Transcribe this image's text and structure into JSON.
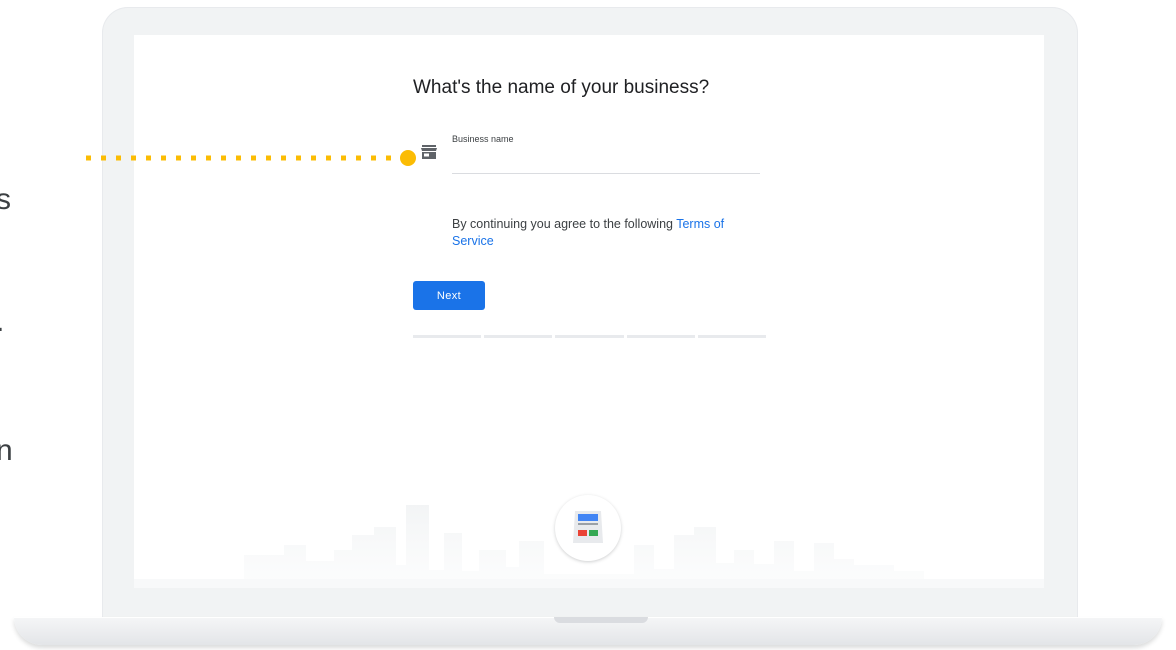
{
  "edge_fragments": [
    "s",
    ".",
    "n"
  ],
  "form": {
    "title": "What's the name of your business?",
    "field_label": "Business name",
    "field_value": "",
    "terms_prefix": "By continuing you agree to the following ",
    "terms_link": "Terms of Service",
    "next_label": "Next"
  },
  "progress": {
    "steps": 5,
    "current": 0
  },
  "colors": {
    "accent": "#1a73e8",
    "connector": "#fbbc04",
    "icon_gray": "#5f6368",
    "progress_track": "#e8eaed"
  },
  "icons": {
    "field_icon": "storefront-icon",
    "badge_icon": "business-listing-icon"
  }
}
